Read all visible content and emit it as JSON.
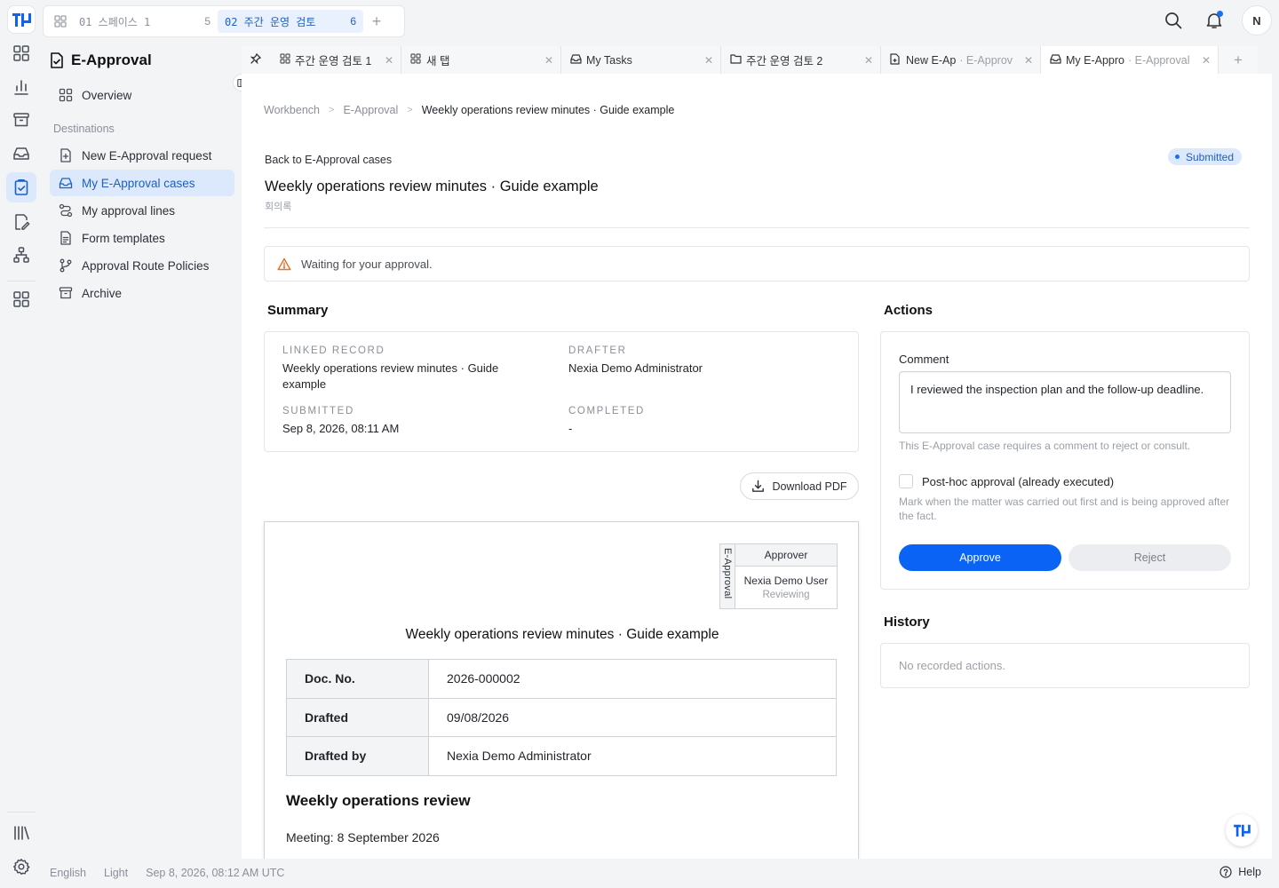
{
  "spaces": [
    {
      "label": "01 스페이스 1",
      "count": "5"
    },
    {
      "label": "02 주간 운영 검토",
      "count": "6"
    }
  ],
  "profile": {
    "initial": "N"
  },
  "nav": {
    "title": "E-Approval",
    "overview": "Overview",
    "section": "Destinations",
    "items": [
      "New E-Approval request",
      "My E-Approval cases",
      "My approval lines",
      "Form templates",
      "Approval Route Policies",
      "Archive"
    ]
  },
  "tabs": [
    {
      "label": "주간 운영 검토 1",
      "sub": ""
    },
    {
      "label": "새 탭",
      "sub": ""
    },
    {
      "label": "My Tasks",
      "sub": ""
    },
    {
      "label": "주간 운영 검토 2",
      "sub": ""
    },
    {
      "label": "New E-Ap",
      "sub": "· E-Approv"
    },
    {
      "label": "My E-Appro",
      "sub": "· E-Approval"
    }
  ],
  "breadcrumb": [
    "Workbench",
    "E-Approval",
    "Weekly operations review minutes · Guide example"
  ],
  "page": {
    "back": "Back to E-Approval cases",
    "status": "Submitted",
    "title": "Weekly operations review minutes · Guide example",
    "type": "회의록",
    "alert": "Waiting for your approval."
  },
  "summary": {
    "heading": "Summary",
    "linked_label": "LINKED RECORD",
    "linked_value": "Weekly operations review minutes · Guide example",
    "drafter_label": "DRAFTER",
    "drafter_value": "Nexia Demo Administrator",
    "submitted_label": "SUBMITTED",
    "submitted_value": "Sep 8, 2026, 08:11 AM",
    "completed_label": "COMPLETED",
    "completed_value": "-"
  },
  "download_pdf": "Download PDF",
  "document": {
    "stamp_side": "E-Approval",
    "stamp_head": "Approver",
    "stamp_name": "Nexia Demo User",
    "stamp_status": "Reviewing",
    "title": "Weekly operations review minutes · Guide example",
    "rows": [
      {
        "k": "Doc. No.",
        "v": "2026-000002"
      },
      {
        "k": "Drafted",
        "v": "09/08/2026"
      },
      {
        "k": "Drafted by",
        "v": "Nexia Demo Administrator"
      }
    ],
    "heading": "Weekly operations review",
    "meeting": "Meeting: 8 September 2026"
  },
  "actions": {
    "heading": "Actions",
    "comment_label": "Comment",
    "comment_value": "I reviewed the inspection plan and the follow-up deadline.",
    "comment_help": "This E-Approval case requires a comment to reject or consult.",
    "posthoc_label": "Post-hoc approval (already executed)",
    "posthoc_help": "Mark when the matter was carried out first and is being approved after the fact.",
    "approve": "Approve",
    "reject": "Reject"
  },
  "history": {
    "heading": "History",
    "empty": "No recorded actions."
  },
  "footer": {
    "language": "English",
    "theme": "Light",
    "time": "Sep 8, 2026, 08:12 AM UTC",
    "help": "Help"
  },
  "colors": {
    "accent": "#0b63f6",
    "active_bg": "#dce8fb",
    "warning": "#e8702a"
  },
  "icons": [
    "logo-icon",
    "grid-icon",
    "chart-icon",
    "archive-icon",
    "inbox-icon",
    "approval-icon",
    "edit-icon",
    "org-icon",
    "apps-icon",
    "library-icon",
    "settings-icon",
    "search-icon",
    "bell-icon",
    "warning-icon",
    "download-icon",
    "help-icon",
    "pin-icon",
    "folder-icon",
    "document-icon"
  ]
}
